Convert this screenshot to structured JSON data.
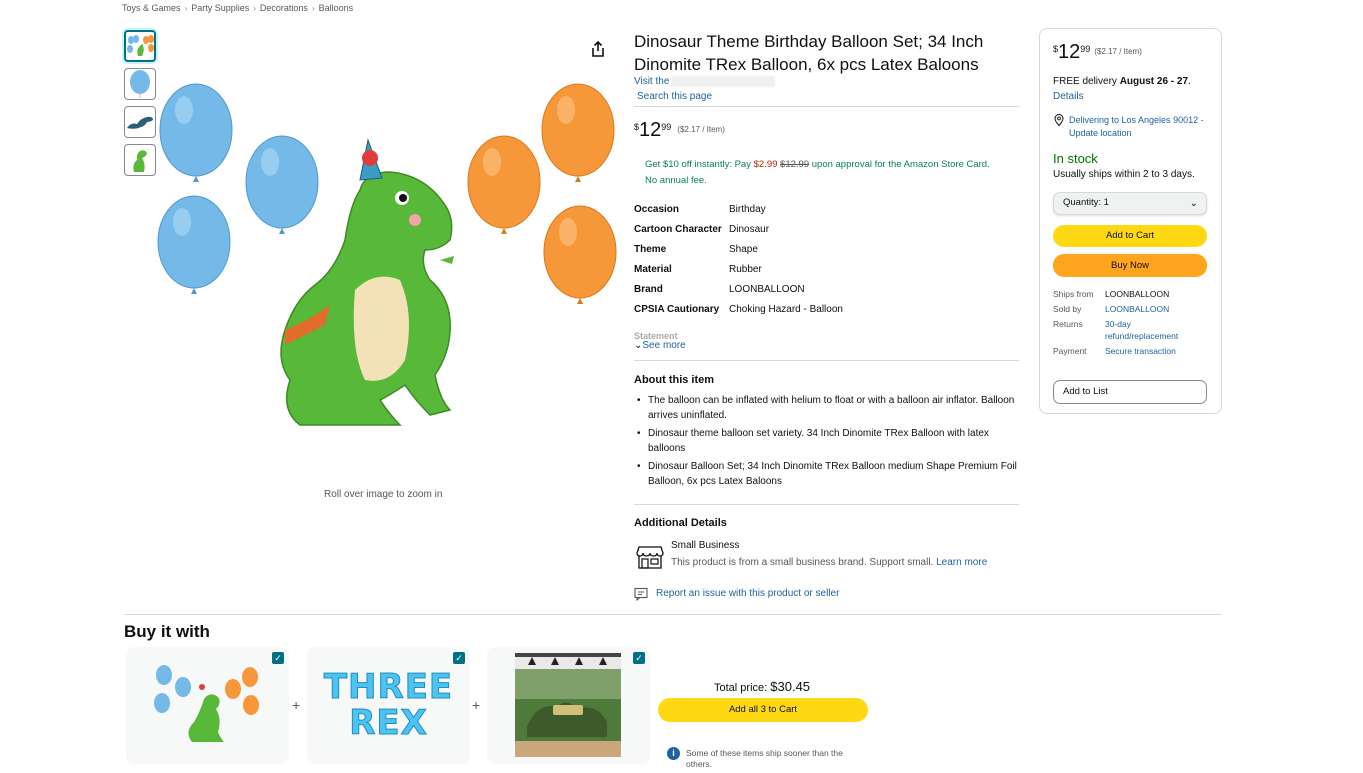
{
  "breadcrumb": [
    "Toys & Games",
    "Party Supplies",
    "Decorations",
    "Balloons"
  ],
  "gallery": {
    "zoom_hint": "Roll over image to zoom in"
  },
  "product": {
    "title": "Dinosaur Theme Birthday Balloon Set; 34 Inch Dinomite TRex Balloon, 6x pcs Latex Baloons",
    "visit_store": "Visit the",
    "search_page": "Search this page",
    "price_symbol": "$",
    "price_whole": "12",
    "price_fraction": "99",
    "unit_price": "($2.17 / Item)",
    "promo_prefix": "Get $10 off instantly: Pay ",
    "promo_pay": "$2.99",
    "promo_strike": "$12.99",
    "promo_suffix": " upon approval for the Amazon Store Card.",
    "promo_line2": "No annual fee."
  },
  "specs": [
    {
      "key": "Occasion",
      "value": "Birthday"
    },
    {
      "key": "Cartoon Character",
      "value": "Dinosaur"
    },
    {
      "key": "Theme",
      "value": "Shape"
    },
    {
      "key": "Material",
      "value": "Rubber"
    },
    {
      "key": "Brand",
      "value": "LOONBALLOON"
    },
    {
      "key": "CPSIA Cautionary",
      "value": "Choking Hazard - Balloon"
    }
  ],
  "specs_fade": "Statement",
  "see_more": "See more",
  "about": {
    "heading": "About this item",
    "bullets": [
      "The balloon can be inflated with helium to float or with a balloon air inflator. Balloon arrives uninflated.",
      "Dinosaur theme balloon set variety. 34 Inch Dinomite TRex Balloon with latex balloons",
      "Dinosaur Balloon Set; 34 Inch Dinomite TRex Balloon medium Shape Premium Foil Balloon, 6x pcs Latex Baloons"
    ]
  },
  "additional": {
    "heading": "Additional Details",
    "small_business_title": "Small Business",
    "small_business_desc": "This product is from a small business brand. Support small.",
    "learn_more": "Learn more",
    "report": "Report an issue with this product or seller"
  },
  "buybox": {
    "price_symbol": "$",
    "price_whole": "12",
    "price_fraction": "99",
    "unit_price": "($2.17 / Item)",
    "delivery_prefix": "FREE delivery ",
    "delivery_date": "August 26 - 27",
    "delivery_suffix": ".",
    "details": "Details",
    "location": "Delivering to Los Angeles 90012 - Update location",
    "stock": "In stock",
    "ships": "Usually ships within 2 to 3 days.",
    "quantity": "Quantity: 1",
    "add_to_cart": "Add to Cart",
    "buy_now": "Buy Now",
    "meta": [
      {
        "key": "Ships from",
        "value": "LOONBALLOON"
      },
      {
        "key": "Sold by",
        "value": "LOONBALLOON"
      },
      {
        "key": "Returns",
        "value": "30-day refund/replacement"
      },
      {
        "key": "Payment",
        "value": "Secure transaction"
      }
    ],
    "add_to_list": "Add to List"
  },
  "buy_it_with": {
    "heading": "Buy it with",
    "card2_text_line1": "THREE",
    "card2_text_line2": "REX",
    "plus": "+",
    "total_label": "Total price:",
    "total_amount": "$30.45",
    "add_all": "Add all 3 to Cart",
    "info": "i",
    "note": "Some of these items ship sooner than the others.",
    "check": "✓"
  },
  "colors": {
    "link": "#2162a1",
    "cart_yellow": "#ffd814",
    "buy_orange": "#ffa41c",
    "in_stock_green": "#007600",
    "teal": "#007185",
    "balloon_blue": "#74b9e8",
    "balloon_orange": "#f6983a",
    "dino_green": "#58b83a"
  }
}
